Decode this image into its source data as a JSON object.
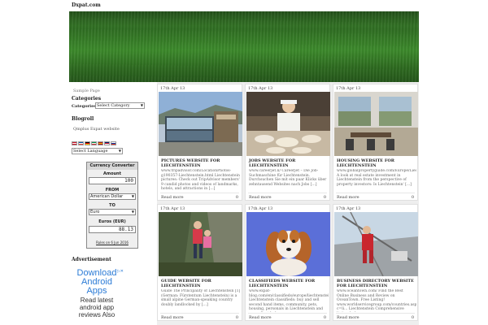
{
  "site": {
    "brand": "Dxpat.com"
  },
  "sidebar": {
    "sample_page": "Sample Page",
    "categories_heading": "Categories",
    "categories_label": "Categories",
    "categories_select": "Select Category",
    "blogroll_heading": "Blogroll",
    "blogroll_item": "Qmplus Expat website",
    "language_select": "Select Language",
    "flag_colors": [
      [
        "#ce1126",
        "#ffffff",
        "#ce1126"
      ],
      [
        "#0055a4",
        "#ffffff",
        "#ef4135"
      ],
      [
        "#000000",
        "#dd0000",
        "#ffce00"
      ],
      [
        "#009246",
        "#ffffff",
        "#ce2b37"
      ],
      [
        "#aa151b",
        "#f1bf00",
        "#aa151b"
      ],
      [
        "#012169",
        "#c8102e",
        "#ffffff"
      ],
      [
        "#ffffff",
        "#0039a6",
        "#d52b1e"
      ]
    ]
  },
  "converter": {
    "title": "Currency Converter",
    "amount_label": "Amount",
    "amount_value": "100",
    "from_label": "FROM",
    "from_value": "American Dollar",
    "to_label": "TO",
    "to_value": "Euro",
    "result_label": "Euros (EUR)",
    "result_value": "88.13",
    "rules": "Rules on 6 Jun 2016"
  },
  "advertisement": {
    "heading": "Advertisement",
    "line1": "Download",
    "line2": "Android",
    "line3": "Apps",
    "line4": "Read latest",
    "line5": "android app",
    "line6": "reviews Also"
  },
  "cards": [
    {
      "date": "17th Apr 13",
      "title": "PICTURES WEBSITE FOR LIECHTENSTEIN",
      "text": "www.tripadvisor.com/LocationPhotos-g190357-Liechtenstein.html Liechtenstein pictures: Check out TripAdvisor members' 9 candid photos and videos of landmarks, hotels, and attractions in [...]",
      "more": "Read more",
      "count": "0"
    },
    {
      "date": "17th Apr 13",
      "title": "JOBS WEBSITE FOR LIECHTENSTEIN",
      "text": "www.careerjet.li/ Careerjet – Die Job-Suchmaschine für Liechtenstein. Durchsuchen Sie mit ein paar Klicks über zehntausend Websites nach Jobs [...]",
      "more": "Read more",
      "count": "0"
    },
    {
      "date": "17th Apr 13",
      "title": "HOUSING WEBSITE FOR LIECHTENSTEIN",
      "text": "www.globalpropertyguide.com/Europe/Liechtenstein A look at real estate investment in Liechtenstein from the perspective of property investors: Is Liechtenstein' [...]",
      "more": "Read more",
      "count": "0"
    },
    {
      "date": "17th Apr 13",
      "title": "GUIDE WEBSITE FOR LIECHTENSTEIN",
      "text": "Guide The Principality of Liechtenstein [1] (German: Fürstentum Liechtenstein) is a small alpine German-speaking country doubly landlocked by [...]",
      "more": "Read more",
      "count": "0"
    },
    {
      "date": "17th Apr 13",
      "title": "CLASSIFIEDS WEBSITE FOR LIECHTENSTEIN",
      "text": "www.expat-blog.com/en/classifieds/europe/liechtenstein Liechtenstein classifieds: buy and sell second hand items, community, pets, housing, personals in Liechtenstein and more. Post [...]",
      "more": "Read more",
      "count": "0"
    },
    {
      "date": "17th Apr 13",
      "title": "BUSINESS DIRECTORY WEBSITE FOR LIECHTENSTEIN",
      "text": "www.oceantown.com/ Find the Best Online Business and Review on OceanTown. Free Listing! www.worldservicegroup.com/countries.asp?c=li... Liechtenstein Comprehensive listing [...]",
      "more": "Read more",
      "count": "0"
    }
  ]
}
